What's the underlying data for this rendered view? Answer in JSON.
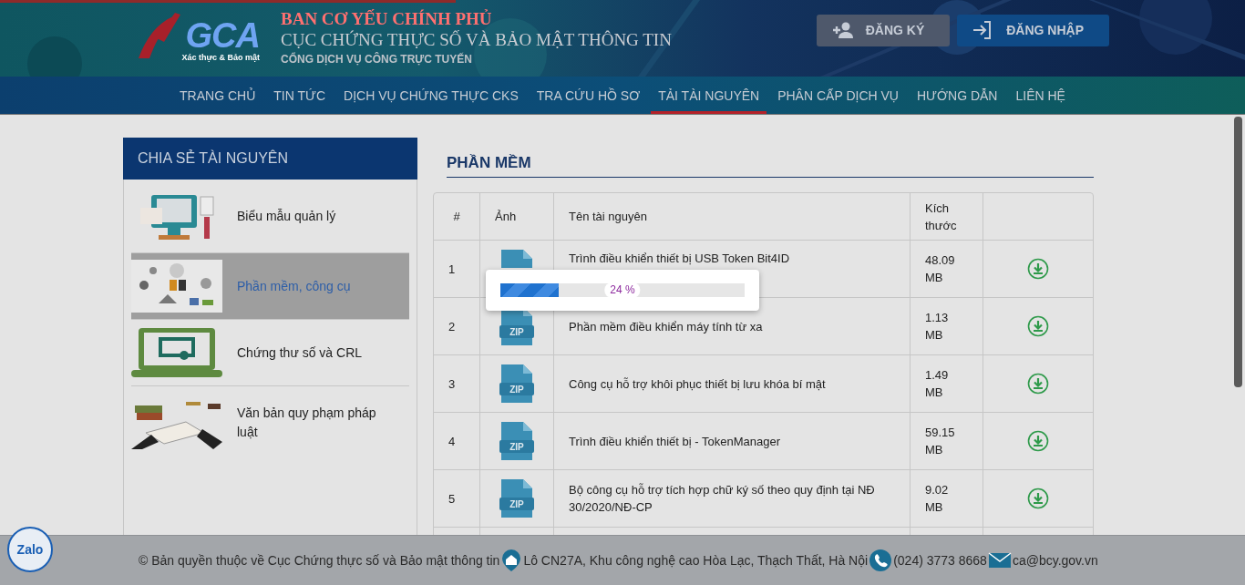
{
  "header": {
    "logo": {
      "text": "GCA",
      "tagline": "Xác thực & Bảo mật"
    },
    "agency": "BAN CƠ YẾU CHÍNH PHỦ",
    "title": "CỤC CHỨNG THỰC SỐ VÀ BẢO MẬT THÔNG TIN",
    "subtitle": "CỔNG DỊCH VỤ CÔNG TRỰC TUYẾN",
    "buttons": [
      {
        "kind": "register",
        "label": "ĐĂNG KÝ"
      },
      {
        "kind": "login",
        "label": "ĐĂNG NHẬP"
      }
    ]
  },
  "nav": [
    {
      "label": "TRANG CHỦ",
      "selected": false
    },
    {
      "label": "TIN TỨC",
      "selected": false
    },
    {
      "label": "DỊCH VỤ CHỨNG THỰC CKS",
      "selected": false
    },
    {
      "label": "TRA CỨU HỒ SƠ",
      "selected": false
    },
    {
      "label": "TẢI TÀI NGUYÊN",
      "selected": true
    },
    {
      "label": "PHÂN CẤP DỊCH VỤ",
      "selected": false
    },
    {
      "label": "HƯỚNG DẪN",
      "selected": false
    },
    {
      "label": "LIÊN HỆ",
      "selected": false
    }
  ],
  "sidebar": {
    "title": "CHIA SẺ TÀI NGUYÊN",
    "items": [
      {
        "label": "Biểu mẫu quản lý",
        "selected": false
      },
      {
        "label": "Phần mềm, công cụ",
        "selected": true
      },
      {
        "label": "Chứng thư số và CRL",
        "selected": false
      },
      {
        "label": "Văn bản quy phạm pháp luật",
        "selected": false
      }
    ]
  },
  "section_title": "PHẦN MỀM",
  "table": {
    "columns": [
      "#",
      "Ảnh",
      "Tên tài nguyên",
      "Kích thước"
    ],
    "rows": [
      {
        "index": "1",
        "name": "Trình điều khiển thiết bị USB Token Bit4ID",
        "size": "48.09 MB"
      },
      {
        "index": "2",
        "file_type": "ZIP",
        "name": "Phần mềm điều khiển máy tính từ xa",
        "size": "1.13 MB"
      },
      {
        "index": "3",
        "file_type": "ZIP",
        "name": "Công cụ hỗ trợ khôi phục thiết bị lưu khóa bí mật",
        "size": "1.49 MB"
      },
      {
        "index": "4",
        "file_type": "ZIP",
        "name": "Trình điều khiển thiết bị - TokenManager",
        "size": "59.15 MB"
      },
      {
        "index": "5",
        "file_type": "ZIP",
        "name": "Bộ công cụ hỗ trợ tích hợp chữ ký số theo quy định tại NĐ 30/2020/NĐ-CP",
        "size": "9.02 MB"
      }
    ]
  },
  "progress": {
    "level": 0.24,
    "label": "24 %"
  },
  "footer": {
    "copyright": "© Bản quyền thuộc về Cục Chứng thực số và Bảo mật thông tin",
    "address": "Lô CN27A, Khu công nghệ cao Hòa Lạc, Thạch Thất, Hà Nội",
    "phone": "(024) 3773 8668",
    "email": "ca@bcy.gov.vn"
  },
  "chat_button": {
    "label": "Zalo"
  }
}
